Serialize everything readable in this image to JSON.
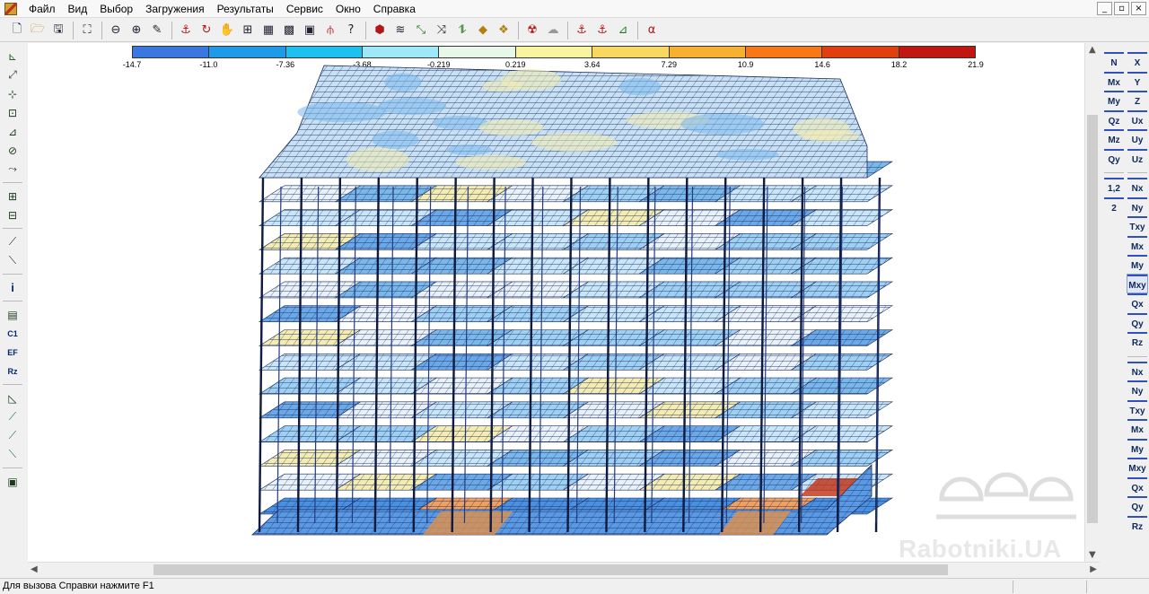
{
  "menu": {
    "items": [
      "Файл",
      "Вид",
      "Выбор",
      "Загружения",
      "Результаты",
      "Сервис",
      "Окно",
      "Справка"
    ]
  },
  "window_controls": [
    "_",
    "▫",
    "×"
  ],
  "toolbar": {
    "buttons": [
      "new-icon",
      "open-icon",
      "save-icon",
      "fit-icon",
      "zoom-out-icon",
      "zoom-in-icon",
      "pencil-icon",
      "anchor-icon",
      "rotate-icon",
      "hand-icon",
      "frame-icon",
      "grid-icon",
      "fill-icon",
      "mesh-icon",
      "support-icon",
      "help-icon",
      "load-icon",
      "beam-icon",
      "force-icon",
      "deform-icon",
      "shell-icon",
      "mass-icon",
      "cloud-icon",
      "anchor2-icon",
      "anchor3-icon",
      "axis-icon",
      "alpha-icon"
    ],
    "alpha_glyph": "α"
  },
  "scale": {
    "colors": [
      "#3a78e0",
      "#1e9ae8",
      "#1ec0f0",
      "#9ee8f8",
      "#e8f8e8",
      "#f8f4a0",
      "#f8d860",
      "#f8b030",
      "#f87818",
      "#e04010",
      "#c01810",
      "#800808"
    ],
    "labels": [
      "-14.7",
      "-11.0",
      "-7.36",
      "-3.68",
      "-0.219",
      "0.219",
      "3.64",
      "7.29",
      "10.9",
      "14.6",
      "18.2",
      "21.9"
    ]
  },
  "left_bar": {
    "labels": {
      "c1": "C1",
      "ef": "EF",
      "rz": "Rz",
      "info": "i"
    }
  },
  "right_bar": {
    "col1": [
      "N",
      "Mx",
      "My",
      "Qz",
      "Mz",
      "Qy",
      "1,2",
      "2"
    ],
    "col2": [
      "X",
      "Y",
      "Z",
      "Ux",
      "Uy",
      "Uz",
      "Nx",
      "Ny",
      "Txy",
      "Mx",
      "My",
      "Mxy",
      "Qx",
      "Qy",
      "Rz",
      "Nx",
      "Ny",
      "Txy",
      "Mx",
      "My",
      "Mxy",
      "Qx",
      "Qy",
      "Rz"
    ]
  },
  "status": {
    "text": "Для вызова Справки нажмите F1"
  },
  "watermark": {
    "text": "Rabotniki.UA"
  }
}
